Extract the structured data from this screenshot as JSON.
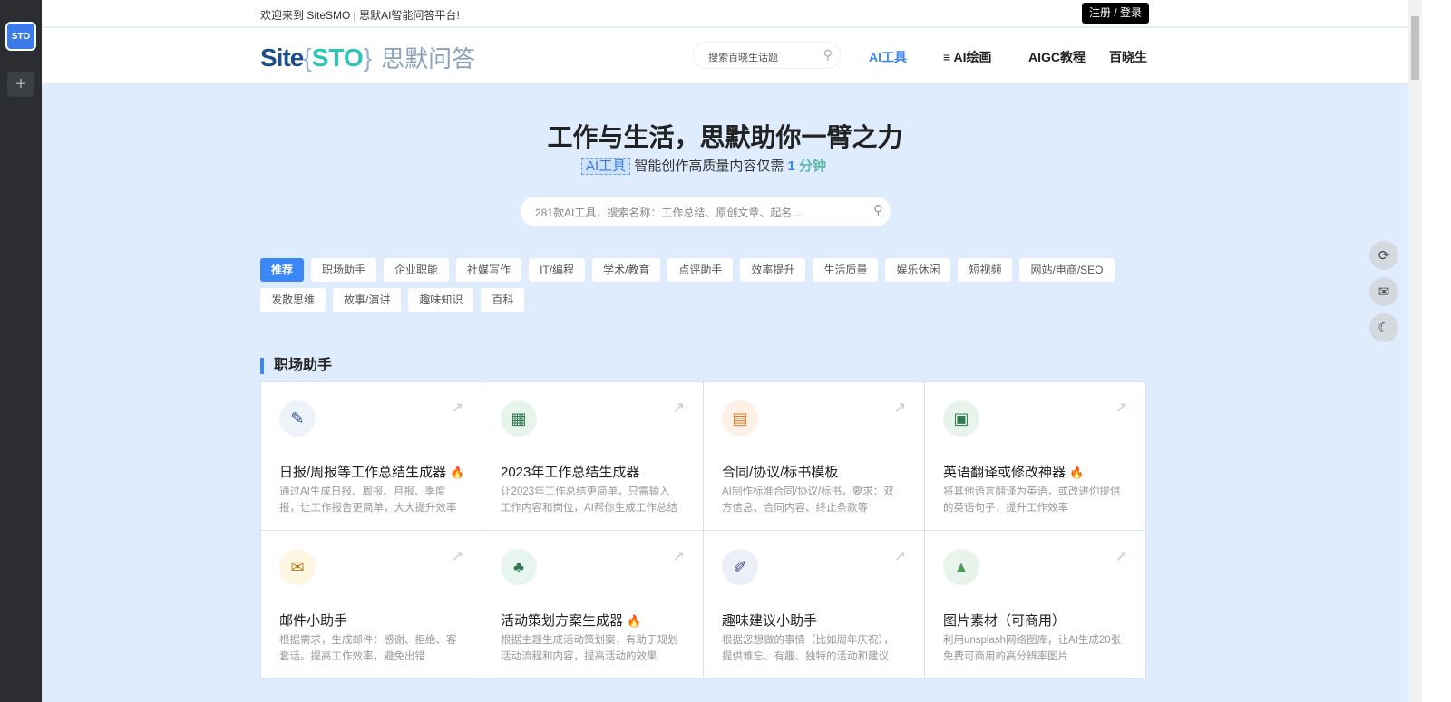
{
  "sidebar": {
    "app_label": "STO",
    "add_label": "+"
  },
  "topbar": {
    "welcome": "欢迎来到 SiteSMO | 思默AI智能问答平台!",
    "login": "注册 / 登录"
  },
  "header": {
    "logo_site": "Site",
    "logo_open": "{",
    "logo_smo": "STO",
    "logo_close": "}",
    "logo_cn": "思默问答",
    "search_placeholder": "搜索百晓生话题",
    "nav": [
      "AI工具",
      "≡ AI绘画",
      "AIGC教程",
      "百晓生"
    ]
  },
  "hero": {
    "title": "工作与生活，思默助你一臂之力",
    "tag": "AI工具",
    "sub": "智能创作高质量内容仅需",
    "num": "1",
    "unit": "分钟",
    "search_placeholder": "281款AI工具，搜索名称：工作总结、原创文章、起名..."
  },
  "categories": [
    "推荐",
    "职场助手",
    "企业职能",
    "社媒写作",
    "IT/编程",
    "学术/教育",
    "点评助手",
    "效率提升",
    "生活质量",
    "娱乐休闲",
    "短视频",
    "网站/电商/SEO",
    "发散思维",
    "故事/演讲",
    "趣味知识",
    "百科"
  ],
  "section": {
    "title": "职场助手"
  },
  "cards": [
    {
      "title": "日报/周报等工作总结生成器",
      "hot": "🔥",
      "desc": "通过AI生成日报、周报、月报、季度报，让工作报告更简单，大大提升效率",
      "icon": "✎",
      "color": "#eef3fa",
      "fg": "#2d5a8c"
    },
    {
      "title": "2023年工作总结生成器",
      "hot": "",
      "desc": "让2023年工作总结更简单，只需输入工作内容和岗位，AI帮你生成工作总结",
      "icon": "▦",
      "color": "#e8f3ec",
      "fg": "#2f7a4e"
    },
    {
      "title": "合同/协议/标书模板",
      "hot": "",
      "desc": "AI制作标准合同/协议/标书，要求：双方信息、合同内容、终止条款等",
      "icon": "▤",
      "color": "#fdf0e6",
      "fg": "#e67a2e"
    },
    {
      "title": "英语翻译或修改神器",
      "hot": "🔥",
      "desc": "将其他语言翻译为英语，或改进你提供的英语句子，提升工作效率",
      "icon": "▣",
      "color": "#e8f3ec",
      "fg": "#2f7a4e"
    },
    {
      "title": "邮件小助手",
      "hot": "",
      "desc": "根据需求，生成邮件：感谢、拒绝、客套话。提高工作效率，避免出错",
      "icon": "✉",
      "color": "#fdf6e0",
      "fg": "#b5771a"
    },
    {
      "title": "活动策划方案生成器",
      "hot": "🔥",
      "desc": "根据主题生成活动策划案，有助于规划活动流程和内容，提高活动的效果",
      "icon": "♣",
      "color": "#e6f5ef",
      "fg": "#2f7a4e"
    },
    {
      "title": "趣味建议小助手",
      "hot": "",
      "desc": "根据您想做的事情（比如周年庆祝），提供难忘、有趣、独特的活动和建议",
      "icon": "✐",
      "color": "#eceff8",
      "fg": "#3a4a7a"
    },
    {
      "title": "图片素材（可商用）",
      "hot": "",
      "desc": "利用unsplash网络图库，让AI生成20张免费可商用的高分辨率图片",
      "icon": "▲",
      "color": "#e8f3ec",
      "fg": "#4a9a5a"
    }
  ],
  "float_buttons": [
    "⟳",
    "✉",
    "☾"
  ],
  "colors": {
    "accent": "#3b87f5",
    "sidebar": "#2b2d30",
    "page_bg": "#dfecfd"
  }
}
